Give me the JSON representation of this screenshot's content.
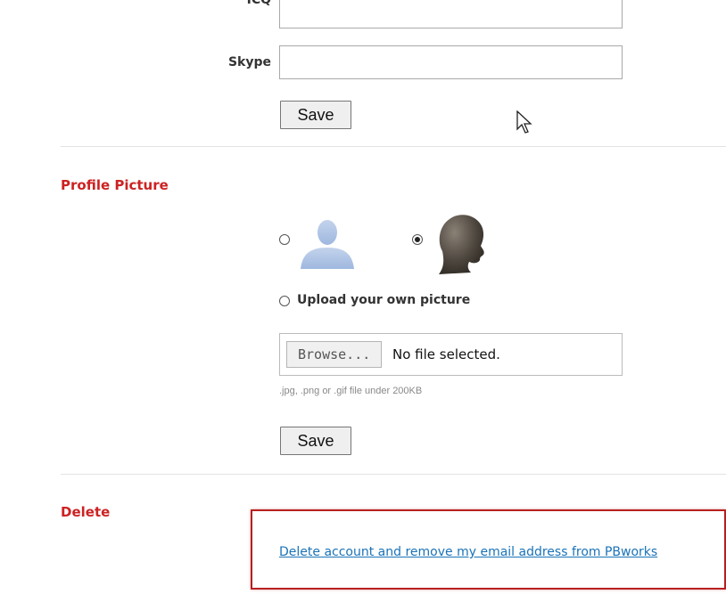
{
  "contact": {
    "icq_label": "ICQ",
    "skype_label": "Skype",
    "icq_value": "",
    "skype_value": "",
    "save_label": "Save"
  },
  "profile_picture": {
    "title": "Profile Picture",
    "options": [
      {
        "icon": "default-avatar-icon",
        "selected": false
      },
      {
        "icon": "silhouette-head-icon",
        "selected": true
      }
    ],
    "upload_label": "Upload your own picture",
    "browse_label": "Browse...",
    "file_status": "No file selected.",
    "hint": ".jpg, .png or .gif file under 200KB",
    "save_label": "Save"
  },
  "delete": {
    "title": "Delete",
    "link_text": "Delete account and remove my email address from PBworks"
  },
  "colors": {
    "section_title": "#cc2222",
    "link": "#1a73b8",
    "highlight_border": "#b81f1f"
  }
}
